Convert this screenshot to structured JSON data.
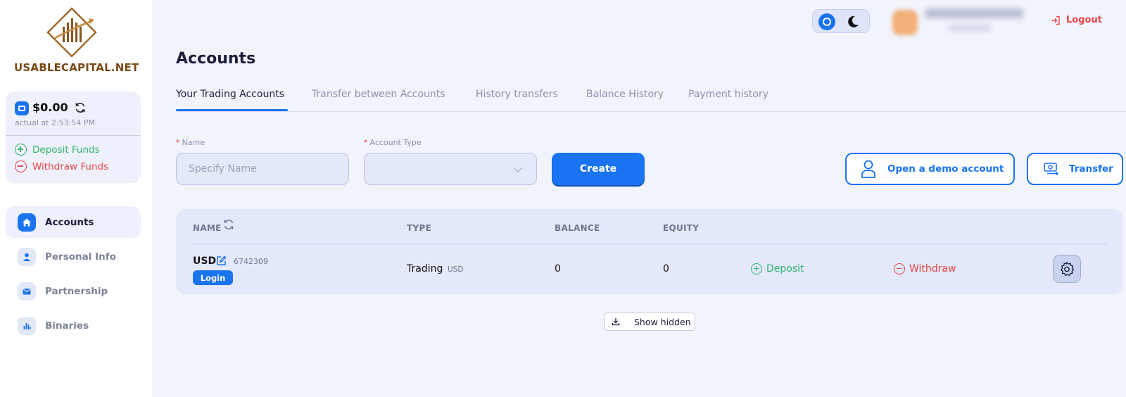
{
  "brand": {
    "name": "USABLECAPITAL.NET"
  },
  "balance": {
    "amount": "$0.00",
    "actual": "actual at 2:53:54 PM",
    "deposit_label": "Deposit Funds",
    "withdraw_label": "Withdraw Funds"
  },
  "sidebar": {
    "items": [
      {
        "label": "Accounts",
        "icon": "home-icon",
        "active": true
      },
      {
        "label": "Personal Info",
        "icon": "user-icon",
        "active": false
      },
      {
        "label": "Partnership",
        "icon": "mail-icon",
        "active": false
      },
      {
        "label": "Binaries",
        "icon": "bar-chart-icon",
        "active": false
      }
    ]
  },
  "header": {
    "logout_label": "Logout",
    "theme": "light"
  },
  "main": {
    "title": "Accounts",
    "tabs": [
      {
        "label": "Your Trading Accounts",
        "active": true
      },
      {
        "label": "Transfer between Accounts",
        "active": false
      },
      {
        "label": "History transfers",
        "active": false
      },
      {
        "label": "Balance History",
        "active": false
      },
      {
        "label": "Payment history",
        "active": false
      }
    ],
    "form": {
      "required_mark": "*",
      "name_label": "Name",
      "name_placeholder": "Specify Name",
      "type_label": "Account Type",
      "type_value": "",
      "create_label": "Create"
    },
    "demo_label": "Open a demo account",
    "transfer_label": "Transfer",
    "table": {
      "headers": {
        "name": "NAME",
        "type": "TYPE",
        "balance": "BALANCE",
        "equity": "EQUITY"
      },
      "rows": [
        {
          "currency": "USD",
          "number": "6742309",
          "login_label": "Login",
          "type": "Trading",
          "type_currency": "USD",
          "balance": "0",
          "equity": "0",
          "deposit_label": "Deposit",
          "withdraw_label": "Withdraw"
        }
      ]
    },
    "show_hidden_label": "Show hidden"
  },
  "colors": {
    "accent": "#1a73f0",
    "positive": "#2fb56a",
    "negative": "#e84545",
    "background": "#f2f4fc"
  }
}
